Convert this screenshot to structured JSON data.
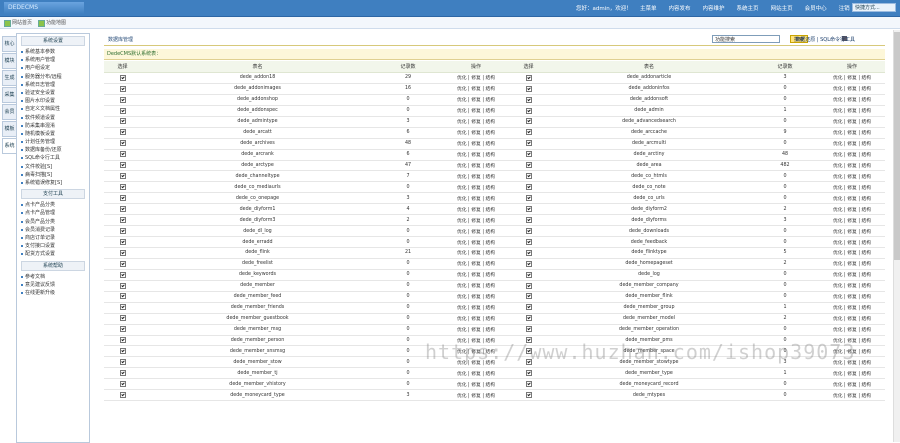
{
  "header": {
    "logo_text": "DEDECMS",
    "welcome": "您好：admin，欢迎！",
    "nav": [
      "主菜单",
      "内容发布",
      "内容维护",
      "系统主页",
      "网站主页",
      "会员中心",
      "注销"
    ],
    "quick_select": "快捷方式..."
  },
  "subbar": {
    "left1": "网站首页",
    "left2": "功能地图"
  },
  "search": {
    "placeholder": "功能搜索",
    "button": "搜索"
  },
  "vtabs": [
    "核心",
    "模块",
    "生成",
    "采集",
    "会员",
    "模板",
    "系统"
  ],
  "sidebar": {
    "sections": [
      {
        "title": "系统设置",
        "items": [
          "系统基本参数",
          "系统用户管理",
          "用户组设定",
          "服务器分布/远程",
          "系统日志管理",
          "验证安全设置",
          "图片水印设置",
          "自定义文档属性",
          "软件频道设置",
          "防采集串混淆",
          "随机模板设置",
          "计划任务管理",
          "数据库备份/还原",
          "SQL命令行工具",
          "文件校验[S]",
          "病毒扫描[S]",
          "系统错误修复[S]"
        ]
      },
      {
        "title": "支付工具",
        "items": [
          "点卡产品分类",
          "点卡产品管理",
          "会员产品分类",
          "会员消费记录",
          "商店订单记录",
          "支付接口设置",
          "配货方式设置"
        ]
      },
      {
        "title": "系统帮助",
        "items": [
          "参考文档",
          "意见建议反馈",
          "在线更新升级"
        ]
      }
    ]
  },
  "main": {
    "title": "数据库管理",
    "links": "数据还原 | SQL命令行工具",
    "db_header": "DedeCMS默认系统表：",
    "columns": [
      "选择",
      "表名",
      "记录数",
      "操作",
      "选择",
      "表名",
      "记录数",
      "操作"
    ],
    "op_label": "优化 | 修复 | 结构",
    "rows": [
      [
        "dede_addon18",
        "29",
        "dede_addonarticle",
        "3"
      ],
      [
        "dede_addonimages",
        "16",
        "dede_addoninfos",
        "0"
      ],
      [
        "dede_addonshop",
        "0",
        "dede_addonsoft",
        "0"
      ],
      [
        "dede_addonspec",
        "0",
        "dede_admin",
        "1"
      ],
      [
        "dede_admintype",
        "3",
        "dede_advancedsearch",
        "0"
      ],
      [
        "dede_arcatt",
        "6",
        "dede_arccache",
        "9"
      ],
      [
        "dede_archives",
        "48",
        "dede_arcmulti",
        "0"
      ],
      [
        "dede_arcrank",
        "6",
        "dede_arctiny",
        "48"
      ],
      [
        "dede_arctype",
        "47",
        "dede_area",
        "482"
      ],
      [
        "dede_channeltype",
        "7",
        "dede_co_htmls",
        "0"
      ],
      [
        "dede_co_mediaurls",
        "0",
        "dede_co_note",
        "0"
      ],
      [
        "dede_co_onepage",
        "3",
        "dede_co_urls",
        "0"
      ],
      [
        "dede_diyform1",
        "4",
        "dede_diyform2",
        "2"
      ],
      [
        "dede_diyform3",
        "2",
        "dede_diyforms",
        "3"
      ],
      [
        "dede_dl_log",
        "0",
        "dede_downloads",
        "0"
      ],
      [
        "dede_erradd",
        "0",
        "dede_feedback",
        "0"
      ],
      [
        "dede_flink",
        "21",
        "dede_flinktype",
        "5"
      ],
      [
        "dede_freelist",
        "0",
        "dede_homepageset",
        "2"
      ],
      [
        "dede_keywords",
        "0",
        "dede_log",
        "0"
      ],
      [
        "dede_member",
        "0",
        "dede_member_company",
        "0"
      ],
      [
        "dede_member_feed",
        "0",
        "dede_member_flink",
        "0"
      ],
      [
        "dede_member_friends",
        "0",
        "dede_member_group",
        "1"
      ],
      [
        "dede_member_guestbook",
        "0",
        "dede_member_model",
        "2"
      ],
      [
        "dede_member_msg",
        "0",
        "dede_member_operation",
        "0"
      ],
      [
        "dede_member_person",
        "0",
        "dede_member_pms",
        "0"
      ],
      [
        "dede_member_snsmsg",
        "0",
        "dede_member_space",
        "0"
      ],
      [
        "dede_member_stow",
        "0",
        "dede_member_stowtype",
        "3"
      ],
      [
        "dede_member_tj",
        "0",
        "dede_member_type",
        "1"
      ],
      [
        "dede_member_vhistory",
        "0",
        "dede_moneycard_record",
        "0"
      ],
      [
        "dede_moneycard_type",
        "3",
        "dede_mtypes",
        "0"
      ]
    ]
  },
  "watermark": "https://www.huzhan.com/ishop39073"
}
